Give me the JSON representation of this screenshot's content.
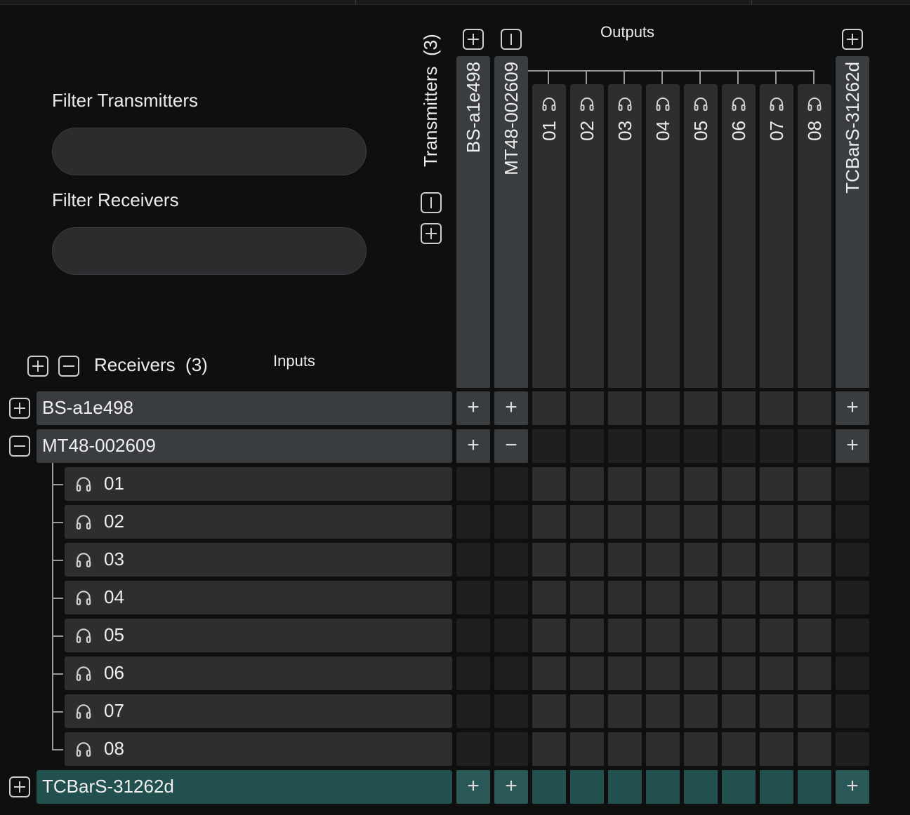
{
  "filters": {
    "transmitters_label": "Filter Transmitters",
    "transmitters_value": "",
    "receivers_label": "Filter Receivers",
    "receivers_value": ""
  },
  "transmitters": {
    "label": "Transmitters",
    "count": "(3)",
    "outputs_label": "Outputs",
    "columns": [
      {
        "label": "BS-a1e498"
      },
      {
        "label": "MT48-002609"
      },
      {
        "label": "01"
      },
      {
        "label": "02"
      },
      {
        "label": "03"
      },
      {
        "label": "04"
      },
      {
        "label": "05"
      },
      {
        "label": "06"
      },
      {
        "label": "07"
      },
      {
        "label": "08"
      },
      {
        "label": "TCBarS-31262d"
      }
    ]
  },
  "receivers": {
    "label": "Receivers",
    "count": "(3)",
    "inputs_label": "Inputs",
    "rows": [
      {
        "label": "BS-a1e498"
      },
      {
        "label": "MT48-002609"
      },
      {
        "label": "01"
      },
      {
        "label": "02"
      },
      {
        "label": "03"
      },
      {
        "label": "04"
      },
      {
        "label": "05"
      },
      {
        "label": "06"
      },
      {
        "label": "07"
      },
      {
        "label": "08"
      },
      {
        "label": "TCBarS-31262d"
      }
    ]
  },
  "matrix_symbols": {
    "plus": "+",
    "minus": "−"
  },
  "colors": {
    "background": "#0f0f10",
    "header": "#3a3d40",
    "sub_header": "#2c2e30",
    "selected_row": "#22504f",
    "selected_cell": "#2a5857"
  }
}
